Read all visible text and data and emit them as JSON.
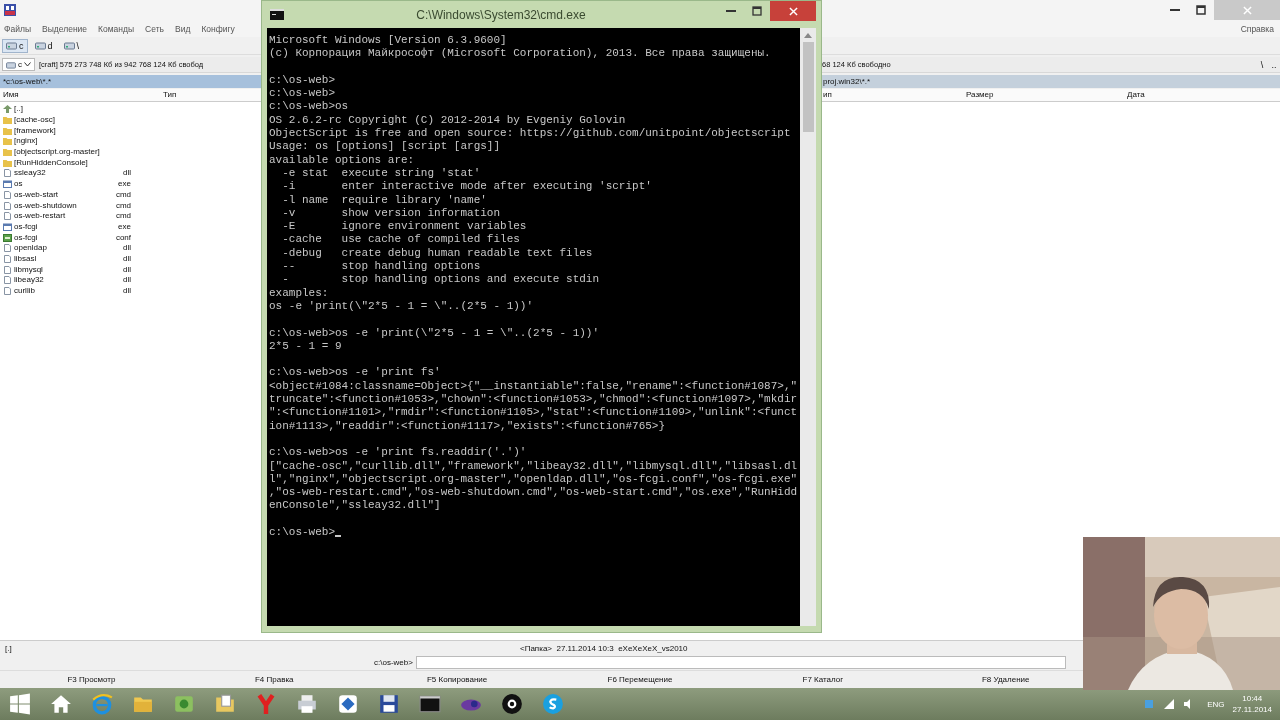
{
  "file_manager": {
    "menu": [
      "Файлы",
      "Выделение",
      "Команды",
      "Сеть",
      "Вид",
      "Конфигу"
    ],
    "help_menu": "Справка",
    "drives": [
      {
        "label": "c",
        "selected": true
      },
      {
        "label": "d",
        "selected": false
      },
      {
        "label": "\\",
        "selected": false
      }
    ],
    "left_panel": {
      "drive": "c",
      "free_space": "[craft]  575 273 748 Кб из 942 768 124 Кб свобод",
      "path": "*c:\\os-web\\*.*",
      "active": true,
      "columns": [
        "Имя",
        "Тип"
      ],
      "files": [
        {
          "name": "[..]",
          "kind": "up"
        },
        {
          "name": "[cache-osc]",
          "kind": "folder"
        },
        {
          "name": "[framework]",
          "kind": "folder"
        },
        {
          "name": "[nginx]",
          "kind": "folder"
        },
        {
          "name": "[objectscript.org-master]",
          "kind": "folder"
        },
        {
          "name": "[RunHiddenConsole]",
          "kind": "folder"
        },
        {
          "name": "ssleay32",
          "ext": "dll",
          "kind": "file"
        },
        {
          "name": "os",
          "ext": "exe",
          "kind": "exe"
        },
        {
          "name": "os-web-start",
          "ext": "cmd",
          "kind": "file"
        },
        {
          "name": "os-web-shutdown",
          "ext": "cmd",
          "kind": "file"
        },
        {
          "name": "os-web-restart",
          "ext": "cmd",
          "kind": "file"
        },
        {
          "name": "os-fcgi",
          "ext": "exe",
          "kind": "exe"
        },
        {
          "name": "os-fcgi",
          "ext": "conf",
          "kind": "config"
        },
        {
          "name": "openldap",
          "ext": "dll",
          "kind": "file"
        },
        {
          "name": "libsasl",
          "ext": "dll",
          "kind": "file"
        },
        {
          "name": "libmysql",
          "ext": "dll",
          "kind": "file"
        },
        {
          "name": "libeay32",
          "ext": "dll",
          "kind": "file"
        },
        {
          "name": "curllib",
          "ext": "dll",
          "kind": "file"
        }
      ],
      "status": "[.]"
    },
    "right_panel": {
      "free_space": "68 124 Кб свободно",
      "nav": [
        "\\",
        ".."
      ],
      "path": "proj.win32\\*.*",
      "active": false,
      "columns": [
        "ип",
        "Размер",
        "Дата"
      ],
      "status": "<Папка>  27.11.2014 10:3  eXeXeXeX_vs2010"
    },
    "command_prompt": "c:\\os-web>",
    "function_keys": [
      "F3 Просмотр",
      "F4 Правка",
      "F5 Копирование",
      "F6 Перемещение",
      "F7 Каталог",
      "F8 Удаление"
    ]
  },
  "console_window": {
    "title": "C:\\Windows\\System32\\cmd.exe",
    "cursor": true,
    "blocks": [
      [
        "Microsoft Windows [Version 6.3.9600]",
        "(c) Корпорация Майкрософт (Microsoft Corporation), 2013. Все права защищены."
      ],
      [
        "c:\\os-web>",
        "c:\\os-web>",
        "c:\\os-web>os",
        "OS 2.6.2-rc Copyright (C) 2012-2014 by Evgeniy Golovin",
        "ObjectScript is free and open source: https://github.com/unitpoint/objectscript",
        "Usage: os [options] [script [args]]",
        "available options are:",
        "  -e stat  execute string 'stat'",
        "  -i       enter interactive mode after executing 'script'",
        "  -l name  require library 'name'",
        "  -v       show version information",
        "  -E       ignore environment variables",
        "  -cache   use cache of compiled files",
        "  -debug   create debug human readable text files",
        "  --       stop handling options",
        "  -        stop handling options and execute stdin",
        "examples:",
        "os -e 'print(\\\"2*5 - 1 = \\\"..(2*5 - 1))'"
      ],
      [
        "c:\\os-web>os -e 'print(\\\"2*5 - 1 = \\\"..(2*5 - 1))'",
        "2*5 - 1 = 9"
      ],
      [
        "c:\\os-web>os -e 'print fs'",
        "<object#1084:classname=Object>{\"__instantiable\":false,\"rename\":<function#1087>,\"",
        "truncate\":<function#1053>,\"chown\":<function#1053>,\"chmod\":<function#1097>,\"mkdir",
        "\":<function#1101>,\"rmdir\":<function#1105>,\"stat\":<function#1109>,\"unlink\":<funct",
        "ion#1113>,\"readdir\":<function#1117>,\"exists\":<function#765>}"
      ],
      [
        "c:\\os-web>os -e 'print fs.readdir('.')'",
        "[\"cache-osc\",\"curllib.dll\",\"framework\",\"libeay32.dll\",\"libmysql.dll\",\"libsasl.dl",
        "l\",\"nginx\",\"objectscript.org-master\",\"openldap.dll\",\"os-fcgi.conf\",\"os-fcgi.exe\"",
        ",\"os-web-restart.cmd\",\"os-web-shutdown.cmd\",\"os-web-start.cmd\",\"os.exe\",\"RunHidd",
        "enConsole\",\"ssleay32.dll\"]"
      ],
      [
        "c:\\os-web>"
      ]
    ]
  },
  "taskbar": {
    "language": "ENG",
    "time": "10:44",
    "date": "27.11.2014"
  }
}
